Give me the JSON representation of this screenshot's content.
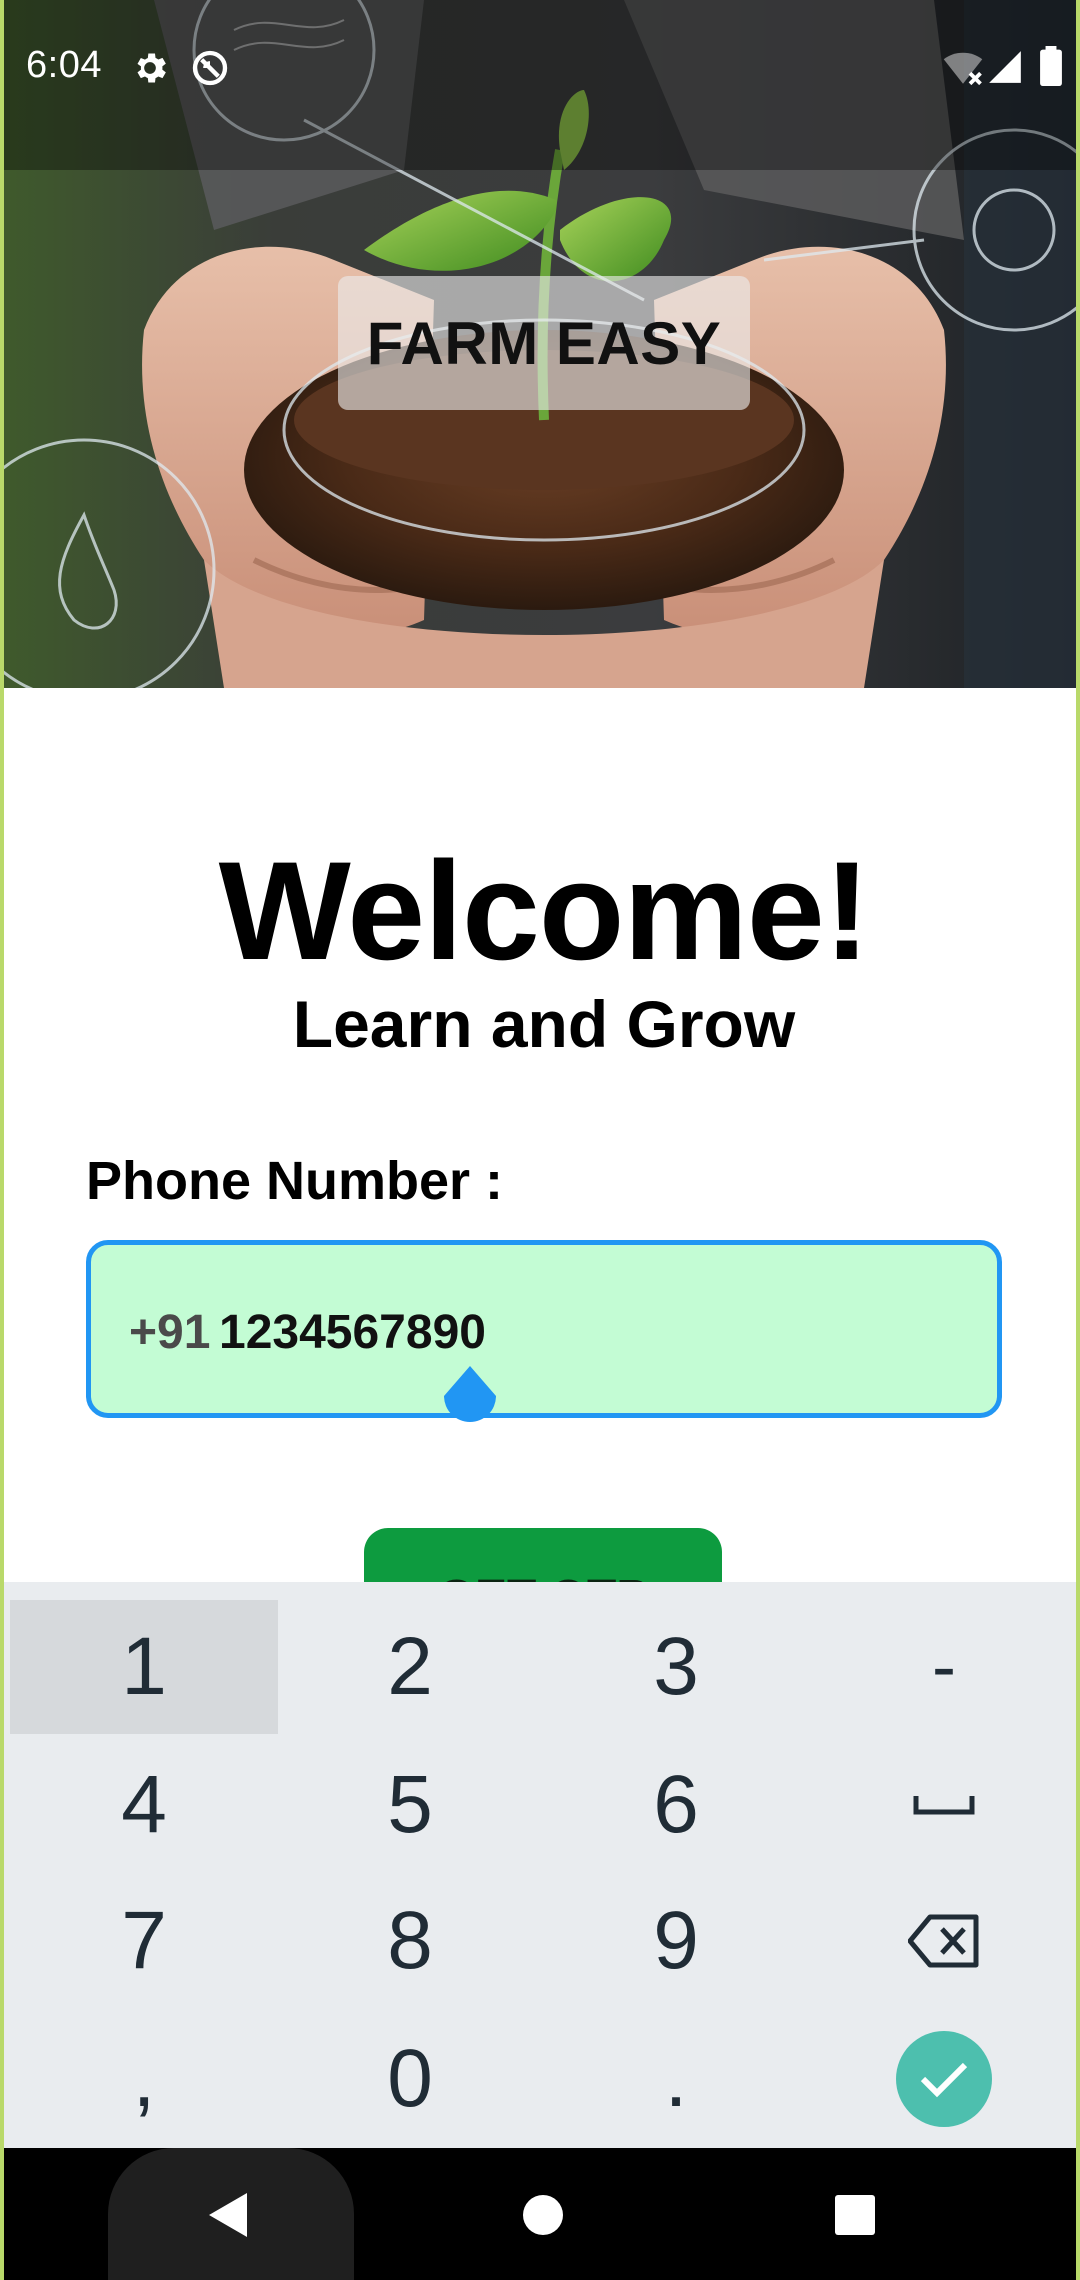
{
  "status_bar": {
    "time": "6:04",
    "icons": [
      "gear-icon",
      "do-not-disturb-icon",
      "wifi-off-icon",
      "cell-signal-icon",
      "battery-icon"
    ]
  },
  "hero": {
    "title": "FARM EASY"
  },
  "welcome": {
    "title": "Welcome!",
    "subtitle": "Learn and Grow"
  },
  "phone": {
    "label": "Phone Number :",
    "prefix": "+91",
    "value": "1234567890"
  },
  "otp_button": {
    "label": "GET OTP"
  },
  "keyboard": {
    "rows": [
      [
        "1",
        "2",
        "3",
        "-"
      ],
      [
        "4",
        "5",
        "6",
        "space"
      ],
      [
        "7",
        "8",
        "9",
        "backspace"
      ],
      [
        ",",
        "0",
        ".",
        "done"
      ]
    ],
    "pressed_key": "1"
  },
  "nav_bar": {
    "buttons": [
      "back",
      "home",
      "recents"
    ]
  },
  "colors": {
    "field_background": "#c3fcd4",
    "field_border": "#2196f3",
    "button_green": "#0d9b3f",
    "keyboard_background": "#e9ecef",
    "enter_key": "#4dbfae"
  }
}
